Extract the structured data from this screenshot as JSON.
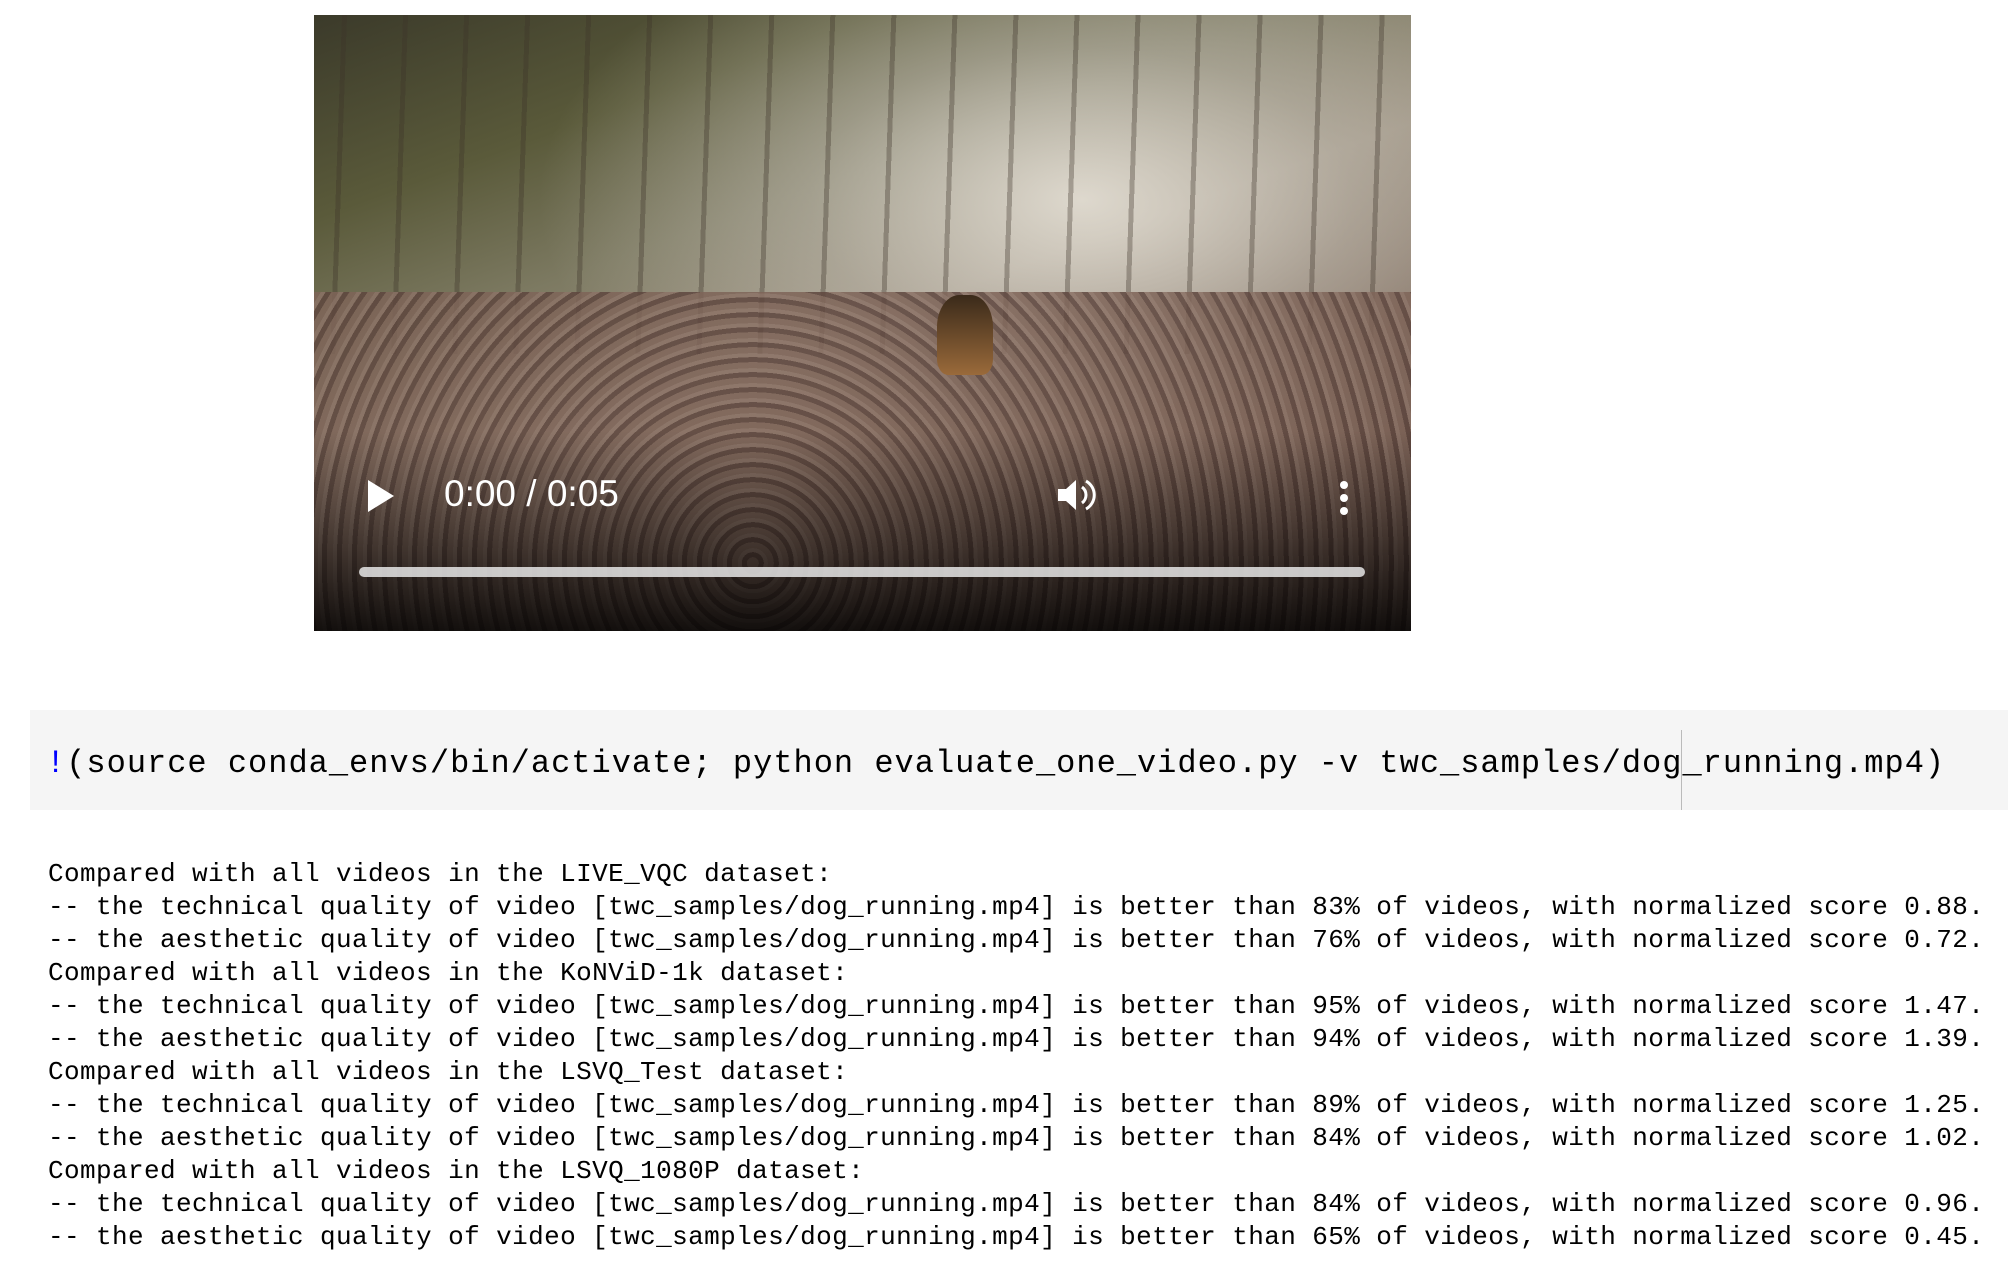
{
  "video": {
    "time_display": "0:00 / 0:05",
    "progress_fraction": 0,
    "icons": [
      "play-icon",
      "volume-icon",
      "more-options-icon"
    ]
  },
  "code_cell": {
    "prefix": "!",
    "command": "(source conda_envs/bin/activate; python evaluate_one_video.py -v twc_samples/dog_running.mp4)"
  },
  "output_lines": [
    "Compared with all videos in the LIVE_VQC dataset:",
    "-- the technical quality of video [twc_samples/dog_running.mp4] is better than 83% of videos, with normalized score 0.88.",
    "-- the aesthetic quality of video [twc_samples/dog_running.mp4] is better than 76% of videos, with normalized score 0.72.",
    "Compared with all videos in the KoNViD-1k dataset:",
    "-- the technical quality of video [twc_samples/dog_running.mp4] is better than 95% of videos, with normalized score 1.47.",
    "-- the aesthetic quality of video [twc_samples/dog_running.mp4] is better than 94% of videos, with normalized score 1.39.",
    "Compared with all videos in the LSVQ_Test dataset:",
    "-- the technical quality of video [twc_samples/dog_running.mp4] is better than 89% of videos, with normalized score 1.25.",
    "-- the aesthetic quality of video [twc_samples/dog_running.mp4] is better than 84% of videos, with normalized score 1.02.",
    "Compared with all videos in the LSVQ_1080P dataset:",
    "-- the technical quality of video [twc_samples/dog_running.mp4] is better than 84% of videos, with normalized score 0.96.",
    "-- the aesthetic quality of video [twc_samples/dog_running.mp4] is better than 65% of videos, with normalized score 0.45."
  ]
}
